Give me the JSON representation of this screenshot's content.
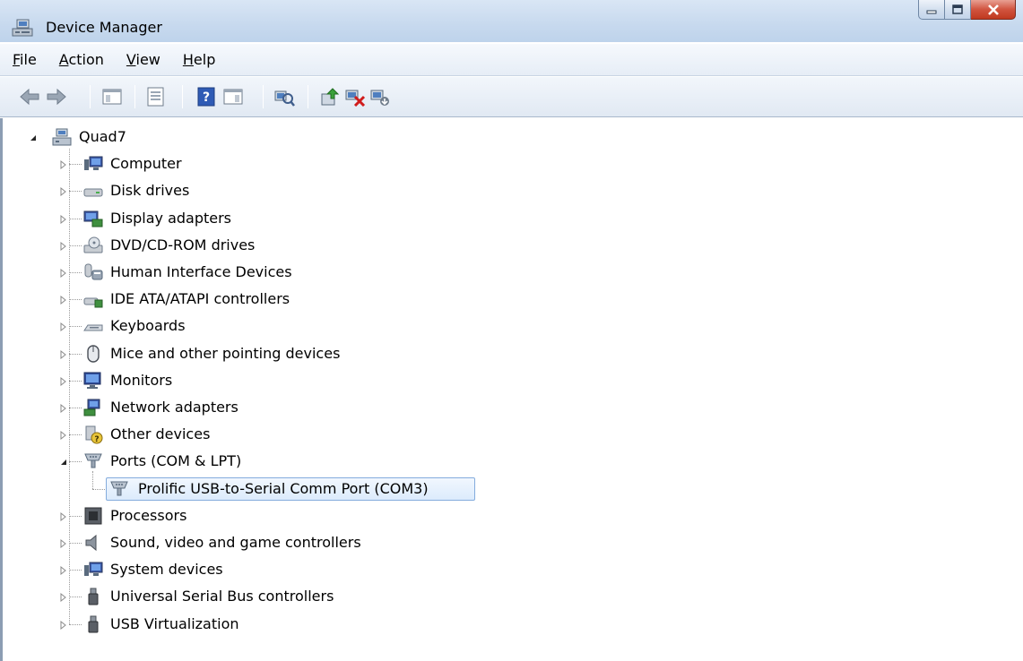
{
  "window": {
    "title": "Device Manager"
  },
  "menu": [
    "File",
    "Action",
    "View",
    "Help"
  ],
  "toolbar": {
    "buttons": [
      {
        "name": "back-button",
        "icon": "arrow-left-icon"
      },
      {
        "name": "forward-button",
        "icon": "arrow-right-icon"
      },
      {
        "name": "show-hide-console-tree-button",
        "icon": "console-tree-icon"
      },
      {
        "name": "properties-button",
        "icon": "properties-icon"
      },
      {
        "name": "help-button",
        "icon": "help-icon"
      },
      {
        "name": "show-hide-action-pane-button",
        "icon": "action-pane-icon"
      },
      {
        "name": "scan-hardware-button",
        "icon": "scan-hardware-icon"
      },
      {
        "name": "update-driver-button",
        "icon": "update-driver-icon"
      },
      {
        "name": "uninstall-button",
        "icon": "uninstall-icon"
      },
      {
        "name": "disable-button",
        "icon": "disable-icon"
      }
    ]
  },
  "tree": {
    "root": {
      "label": "Quad7",
      "icon": "computer-root-icon",
      "expanded": true
    },
    "categories": [
      {
        "label": "Computer",
        "icon": "computer-icon",
        "expanded": false
      },
      {
        "label": "Disk drives",
        "icon": "disk-drive-icon",
        "expanded": false
      },
      {
        "label": "Display adapters",
        "icon": "display-adapter-icon",
        "expanded": false
      },
      {
        "label": "DVD/CD-ROM drives",
        "icon": "dvd-drive-icon",
        "expanded": false
      },
      {
        "label": "Human Interface Devices",
        "icon": "hid-icon",
        "expanded": false
      },
      {
        "label": "IDE ATA/ATAPI controllers",
        "icon": "ide-controller-icon",
        "expanded": false
      },
      {
        "label": "Keyboards",
        "icon": "keyboard-icon",
        "expanded": false
      },
      {
        "label": "Mice and other pointing devices",
        "icon": "mouse-icon",
        "expanded": false
      },
      {
        "label": "Monitors",
        "icon": "monitor-icon",
        "expanded": false
      },
      {
        "label": "Network adapters",
        "icon": "network-adapter-icon",
        "expanded": false
      },
      {
        "label": "Other devices",
        "icon": "other-devices-icon",
        "expanded": false
      },
      {
        "label": "Ports (COM & LPT)",
        "icon": "port-icon",
        "expanded": true,
        "children": [
          {
            "label": "Prolific USB-to-Serial Comm Port (COM3)",
            "icon": "port-icon",
            "selected": true
          }
        ]
      },
      {
        "label": "Processors",
        "icon": "processor-icon",
        "expanded": false
      },
      {
        "label": "Sound, video and game controllers",
        "icon": "sound-icon",
        "expanded": false
      },
      {
        "label": "System devices",
        "icon": "system-devices-icon",
        "expanded": false
      },
      {
        "label": "Universal Serial Bus controllers",
        "icon": "usb-icon",
        "expanded": false
      },
      {
        "label": "USB Virtualization",
        "icon": "usb-icon",
        "expanded": false
      }
    ]
  },
  "colors": {
    "titlebar": "#c7d9ee",
    "selection_border": "#84acdd",
    "close_button": "#d1543f"
  }
}
